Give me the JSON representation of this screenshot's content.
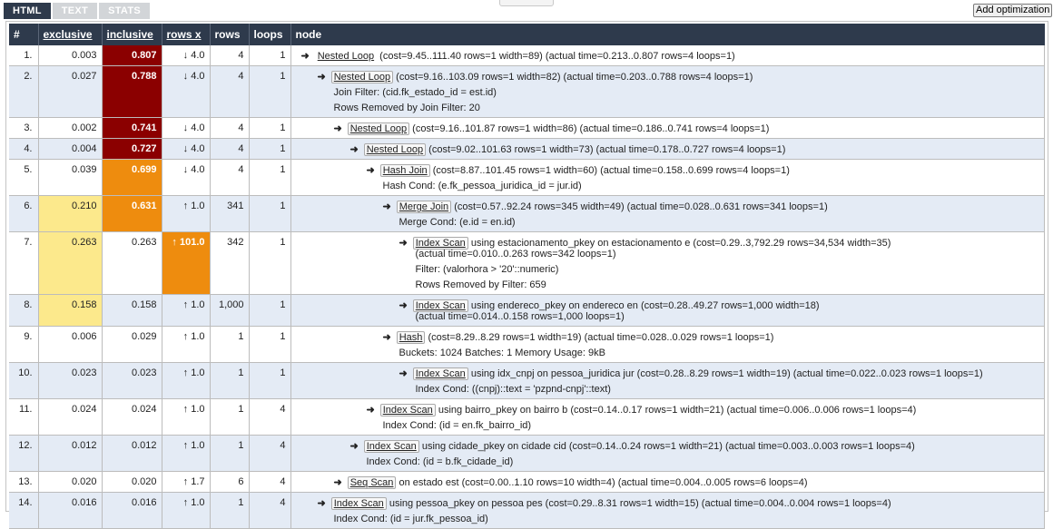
{
  "tabs": [
    "HTML",
    "TEXT",
    "STATS"
  ],
  "add_optimization_label": "Add optimization",
  "columns": [
    "#",
    "exclusive",
    "inclusive",
    "rows x",
    "rows",
    "loops",
    "node"
  ],
  "rows": [
    {
      "idx": "1.",
      "excl": "0.003",
      "incl": "0.807",
      "rowsx": "↓ 4.0",
      "rows": "4",
      "loops": "1",
      "indent": 0,
      "name": "Nested Loop",
      "desc": "(cost=9.45..111.40 rows=1 width=89) (actual time=0.213..0.807 rows=4 loops=1)",
      "extra": []
    },
    {
      "idx": "2.",
      "excl": "0.027",
      "incl": "0.788",
      "rowsx": "↓ 4.0",
      "rows": "4",
      "loops": "1",
      "indent": 1,
      "name": "Nested Loop",
      "desc": "(cost=9.16..103.09 rows=1 width=82) (actual time=0.203..0.788 rows=4 loops=1)",
      "extra": [
        "Join Filter: (cid.fk_estado_id = est.id)",
        "Rows Removed by Join Filter: 20"
      ]
    },
    {
      "idx": "3.",
      "excl": "0.002",
      "incl": "0.741",
      "rowsx": "↓ 4.0",
      "rows": "4",
      "loops": "1",
      "indent": 2,
      "name": "Nested Loop",
      "desc": "(cost=9.16..101.87 rows=1 width=86) (actual time=0.186..0.741 rows=4 loops=1)",
      "extra": []
    },
    {
      "idx": "4.",
      "excl": "0.004",
      "incl": "0.727",
      "rowsx": "↓ 4.0",
      "rows": "4",
      "loops": "1",
      "indent": 3,
      "name": "Nested Loop",
      "desc": "(cost=9.02..101.63 rows=1 width=73) (actual time=0.178..0.727 rows=4 loops=1)",
      "extra": []
    },
    {
      "idx": "5.",
      "excl": "0.039",
      "incl": "0.699",
      "rowsx": "↓ 4.0",
      "rows": "4",
      "loops": "1",
      "indent": 4,
      "name": "Hash Join",
      "desc": "(cost=8.87..101.45 rows=1 width=60) (actual time=0.158..0.699 rows=4 loops=1)",
      "extra": [
        "Hash Cond: (e.fk_pessoa_juridica_id = jur.id)"
      ]
    },
    {
      "idx": "6.",
      "excl": "0.210",
      "incl": "0.631",
      "rowsx": "↑ 1.0",
      "rows": "341",
      "loops": "1",
      "indent": 5,
      "name": "Merge Join",
      "desc": "(cost=0.57..92.24 rows=345 width=49) (actual time=0.028..0.631 rows=341 loops=1)",
      "extra": [
        "Merge Cond: (e.id = en.id)"
      ]
    },
    {
      "idx": "7.",
      "excl": "0.263",
      "incl": "0.263",
      "rowsx": "↑ 101.0",
      "rows": "342",
      "loops": "1",
      "indent": 6,
      "name": "Index Scan",
      "desc": "using estacionamento_pkey on estacionamento e (cost=0.29..3,792.29 rows=34,534 width=35)",
      "desc2": "(actual time=0.010..0.263 rows=342 loops=1)",
      "extra": [
        "Filter: (valorhora > '20'::numeric)",
        "Rows Removed by Filter: 659"
      ]
    },
    {
      "idx": "8.",
      "excl": "0.158",
      "incl": "0.158",
      "rowsx": "↑ 1.0",
      "rows": "1,000",
      "loops": "1",
      "indent": 6,
      "name": "Index Scan",
      "desc": "using endereco_pkey on endereco en (cost=0.28..49.27 rows=1,000 width=18)",
      "desc2": "(actual time=0.014..0.158 rows=1,000 loops=1)",
      "extra": []
    },
    {
      "idx": "9.",
      "excl": "0.006",
      "incl": "0.029",
      "rowsx": "↑ 1.0",
      "rows": "1",
      "loops": "1",
      "indent": 5,
      "name": "Hash",
      "desc": "(cost=8.29..8.29 rows=1 width=19) (actual time=0.028..0.029 rows=1 loops=1)",
      "extra": [
        "Buckets: 1024 Batches: 1 Memory Usage: 9kB"
      ]
    },
    {
      "idx": "10.",
      "excl": "0.023",
      "incl": "0.023",
      "rowsx": "↑ 1.0",
      "rows": "1",
      "loops": "1",
      "indent": 6,
      "name": "Index Scan",
      "desc": "using idx_cnpj on pessoa_juridica jur (cost=0.28..8.29 rows=1 width=19) (actual time=0.022..0.023 rows=1 loops=1)",
      "extra": [
        "Index Cond: ((cnpj)::text = 'pzpnd-cnpj'::text)"
      ]
    },
    {
      "idx": "11.",
      "excl": "0.024",
      "incl": "0.024",
      "rowsx": "↑ 1.0",
      "rows": "1",
      "loops": "4",
      "indent": 4,
      "name": "Index Scan",
      "desc": "using bairro_pkey on bairro b (cost=0.14..0.17 rows=1 width=21) (actual time=0.006..0.006 rows=1 loops=4)",
      "extra": [
        "Index Cond: (id = en.fk_bairro_id)"
      ]
    },
    {
      "idx": "12.",
      "excl": "0.012",
      "incl": "0.012",
      "rowsx": "↑ 1.0",
      "rows": "1",
      "loops": "4",
      "indent": 3,
      "name": "Index Scan",
      "desc": "using cidade_pkey on cidade cid (cost=0.14..0.24 rows=1 width=21) (actual time=0.003..0.003 rows=1 loops=4)",
      "extra": [
        "Index Cond: (id = b.fk_cidade_id)"
      ]
    },
    {
      "idx": "13.",
      "excl": "0.020",
      "incl": "0.020",
      "rowsx": "↑ 1.7",
      "rows": "6",
      "loops": "4",
      "indent": 2,
      "name": "Seq Scan",
      "desc": "on estado est (cost=0.00..1.10 rows=10 width=4) (actual time=0.004..0.005 rows=6 loops=4)",
      "extra": []
    },
    {
      "idx": "14.",
      "excl": "0.016",
      "incl": "0.016",
      "rowsx": "↑ 1.0",
      "rows": "1",
      "loops": "4",
      "indent": 1,
      "name": "Index Scan",
      "desc": "using pessoa_pkey on pessoa pes (cost=0.29..8.31 rows=1 width=15) (actual time=0.004..0.004 rows=1 loops=4)",
      "extra": [
        "Index Cond: (id = jur.fk_pessoa_id)"
      ]
    }
  ],
  "heat": {
    "incl": [
      "dark",
      "dark",
      "dark",
      "dark",
      "orange",
      "orange",
      "",
      "",
      "",
      "",
      "",
      "",
      "",
      ""
    ],
    "excl": [
      "",
      "",
      "",
      "",
      "",
      "yellow",
      "yellow",
      "yellow",
      "",
      "",
      "",
      "",
      "",
      ""
    ],
    "rowsx": [
      "",
      "",
      "",
      "",
      "",
      "",
      "orange",
      "",
      "",
      "",
      "",
      "",
      "",
      ""
    ]
  },
  "colors": {
    "header": "#2e3a4c",
    "dark": "#8b0000",
    "orange": "#ee8c0e",
    "yellow": "#fce98c",
    "even_row": "#e4ebf5"
  }
}
